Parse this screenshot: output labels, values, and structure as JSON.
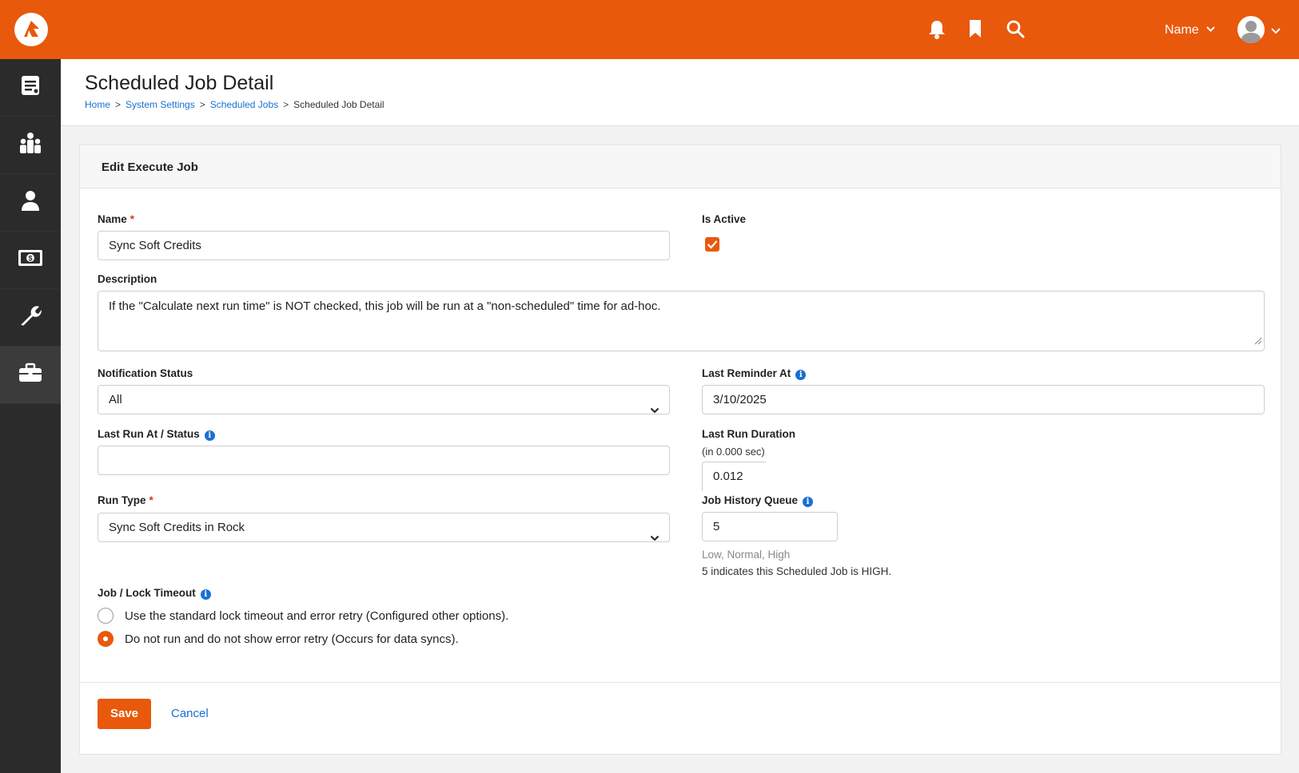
{
  "topbar": {
    "logo_icon": "rock-logo-icon",
    "notifications_icon": "bell-icon",
    "bookmarks_icon": "bookmark-icon",
    "search_icon": "search-icon",
    "user_menu_label": "Name",
    "brand_color": "#e8590c"
  },
  "sidebar": {
    "items": [
      {
        "icon": "notes-icon",
        "active": false
      },
      {
        "icon": "people-group-icon",
        "active": false
      },
      {
        "icon": "person-icon",
        "active": false
      },
      {
        "icon": "money-icon",
        "active": false
      },
      {
        "icon": "wrench-icon",
        "active": false
      },
      {
        "icon": "briefcase-icon",
        "active": true
      }
    ]
  },
  "header": {
    "title": "Scheduled Job Detail",
    "breadcrumb": {
      "home": "Home",
      "sep": ">",
      "system_settings": "System Settings",
      "scheduled_jobs": "Scheduled Jobs",
      "current": "Scheduled Job Detail"
    }
  },
  "form": {
    "panel_title": "Edit Execute Job",
    "name_label": "Name",
    "required_mark": "*",
    "name_value": "Sync Soft Credits",
    "is_active_label": "Is Active",
    "is_active_checked": true,
    "description_label": "Description",
    "description_value": "If the \"Calculate next run time\" is NOT checked, this job will be run at a \"non-scheduled\" time for ad-hoc.",
    "notification_status_label": "Notification Status",
    "notification_status_value": "All",
    "last_reminder_label": "Last Reminder At",
    "last_reminder_value": "3/10/2025",
    "last_run_label": "Last Run At / Status",
    "last_run_value": "",
    "last_run_duration_label": "Last Run Duration",
    "last_run_duration_sublabel": "(in 0.000 sec)",
    "last_run_duration_value": "0.012",
    "run_type_label": "Run Type",
    "run_type_value": "Sync Soft Credits in Rock",
    "job_history_label": "Job History Queue",
    "job_history_value": "5",
    "job_history_help1": "Low, Normal, High",
    "job_history_help2": "5 indicates this Scheduled Job is HIGH.",
    "lock_timeout_label": "Job / Lock Timeout",
    "lock_options": [
      {
        "label": "Use the standard lock timeout and error retry (Configured other options).",
        "checked": false
      },
      {
        "label": "Do not run and do not show error retry (Occurs for data syncs).",
        "checked": true
      }
    ],
    "info_glyph": "i",
    "save_label": "Save",
    "cancel_label": "Cancel"
  }
}
